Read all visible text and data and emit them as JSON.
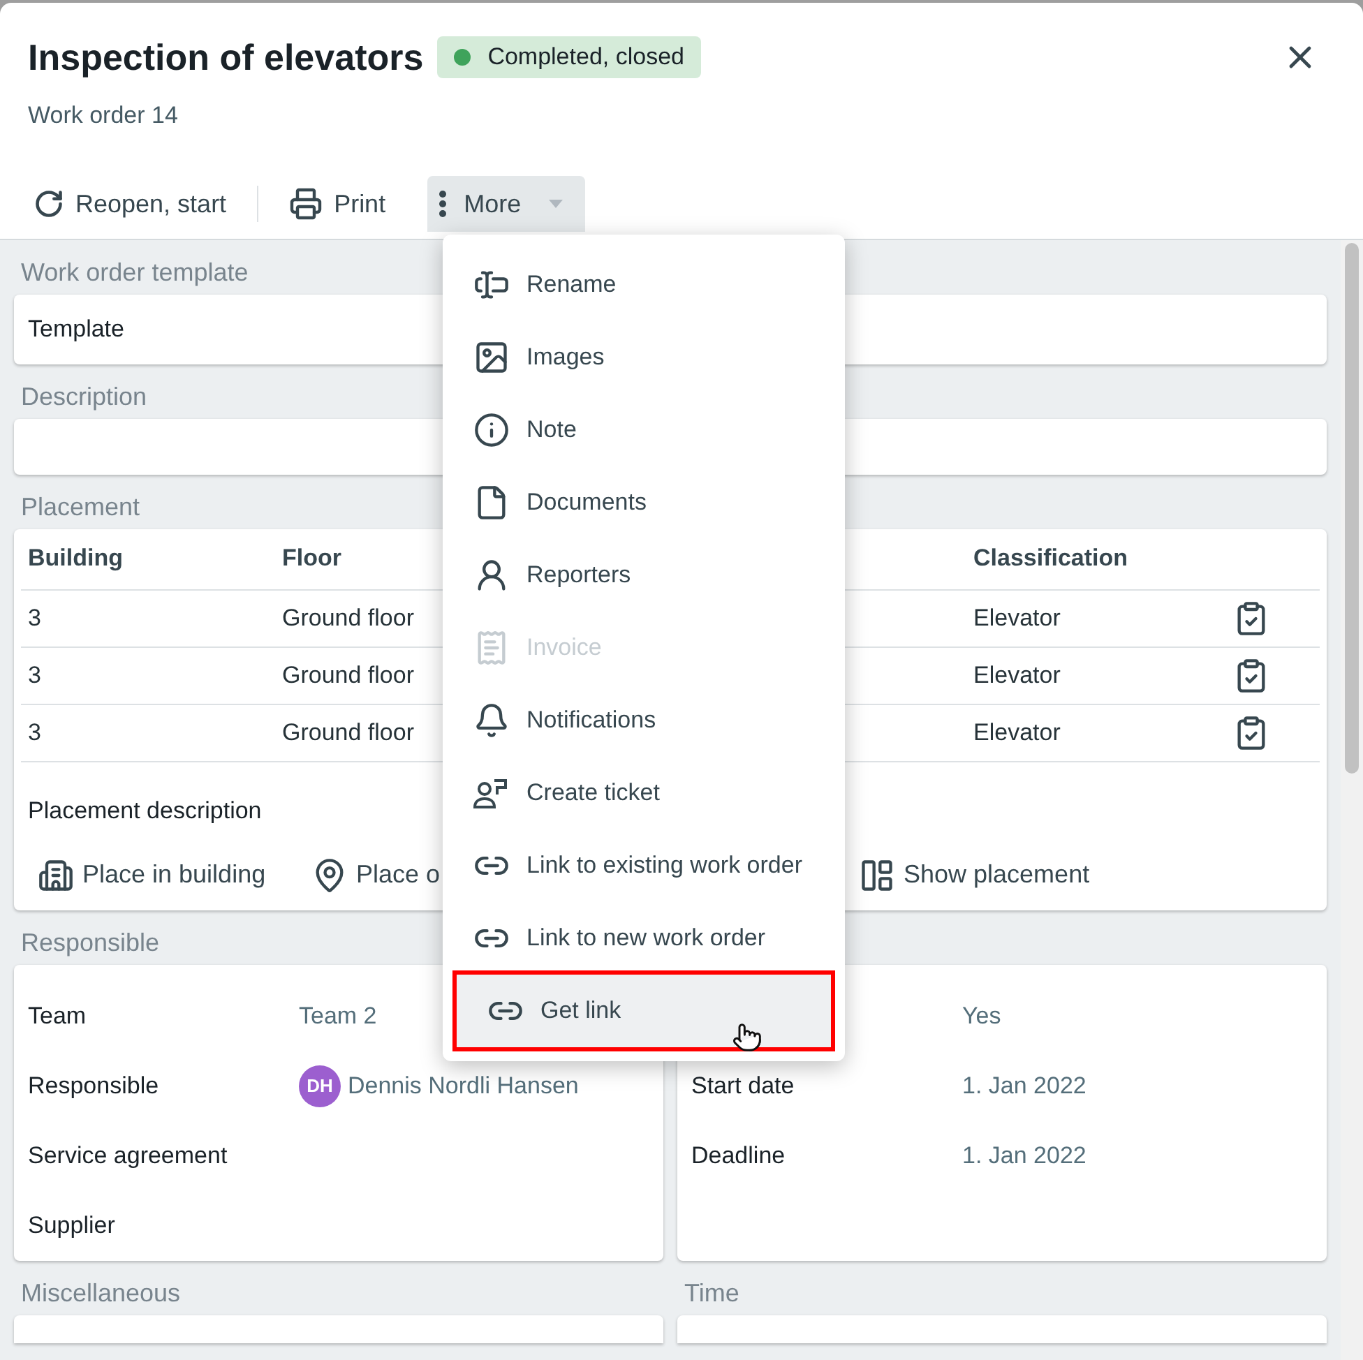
{
  "dialog": {
    "title": "Inspection of elevators",
    "status": {
      "label": "Completed, closed",
      "color": "#3fa35b"
    },
    "subtitle": "Work order 14"
  },
  "toolbar": [
    {
      "kind": "reopen",
      "label": "Reopen, start"
    },
    {
      "kind": "print",
      "label": "Print"
    },
    {
      "kind": "more",
      "label": "More",
      "expanded": true
    }
  ],
  "template_section": {
    "heading": "Work order template",
    "label": "Template"
  },
  "description_section": {
    "heading": "Description"
  },
  "placement": {
    "heading": "Placement",
    "columns": [
      "Building",
      "Floor",
      "Classification"
    ],
    "rows": [
      {
        "cells": [
          "3",
          "Ground floor",
          "Elevator"
        ]
      },
      {
        "cells": [
          "3",
          "Ground floor",
          "Elevator"
        ]
      },
      {
        "cells": [
          "3",
          "Ground floor",
          "Elevator"
        ]
      }
    ],
    "description_label": "Placement description",
    "actions": [
      {
        "kind": "building",
        "label": "Place in building"
      },
      {
        "kind": "pin",
        "label": "Place o"
      },
      {
        "kind": "plan",
        "label": "Show placement"
      }
    ]
  },
  "responsible": {
    "heading": "Responsible",
    "left": [
      {
        "label": "Team",
        "value": "Team 2"
      },
      {
        "label": "Responsible",
        "value": "Dennis Nordli Hansen",
        "avatar": {
          "initials": "DH",
          "color": "#9c5fcf"
        }
      },
      {
        "label": "Service agreement"
      },
      {
        "label": "Supplier"
      }
    ],
    "right": [
      {
        "value": "Yes"
      },
      {
        "label": "Start date",
        "value": "1. Jan 2022"
      },
      {
        "label": "Deadline",
        "value": "1. Jan 2022"
      }
    ]
  },
  "bottom_headings": [
    "Miscellaneous",
    "Time"
  ],
  "menu": {
    "items": [
      {
        "kind": "rename",
        "label": "Rename",
        "disabled": false,
        "selected": false
      },
      {
        "kind": "image",
        "label": "Images",
        "disabled": false,
        "selected": false
      },
      {
        "kind": "info",
        "label": "Note",
        "disabled": false,
        "selected": false
      },
      {
        "kind": "file",
        "label": "Documents",
        "disabled": false,
        "selected": false
      },
      {
        "kind": "person",
        "label": "Reporters",
        "disabled": false,
        "selected": false
      },
      {
        "kind": "receipt",
        "label": "Invoice",
        "disabled": true,
        "selected": false
      },
      {
        "kind": "bell",
        "label": "Notifications",
        "disabled": false,
        "selected": false
      },
      {
        "kind": "ticket",
        "label": "Create ticket",
        "disabled": false,
        "selected": false
      },
      {
        "kind": "link",
        "label": "Link to existing work order",
        "disabled": false,
        "selected": false
      },
      {
        "kind": "link",
        "label": "Link to new work order",
        "disabled": false,
        "selected": false
      },
      {
        "kind": "link",
        "label": "Get link",
        "disabled": false,
        "selected": true
      }
    ]
  }
}
